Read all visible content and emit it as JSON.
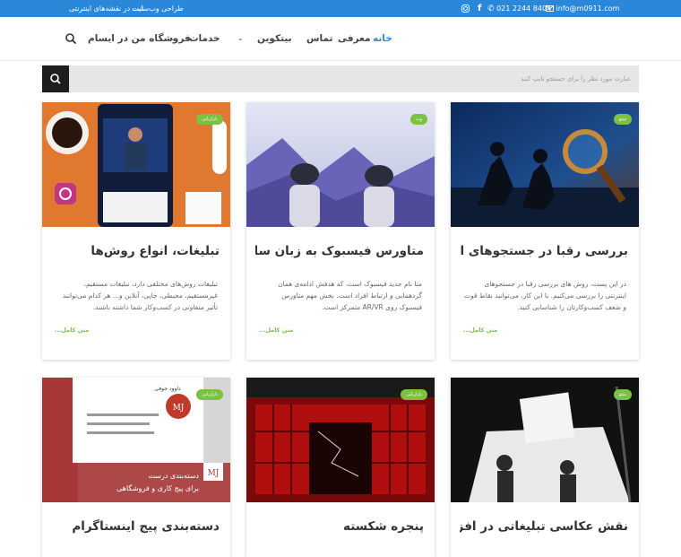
{
  "topbar": {
    "email": "info@m0911.com",
    "phone": "021 2244 8404",
    "link_web": "طراحی وب‌سایت",
    "link_maps": "ثبت در نقشه‌های اینترنتی",
    "icons": [
      "email-icon",
      "phone-icon",
      "facebook-icon",
      "instagram-icon"
    ]
  },
  "nav": {
    "home": "خانه",
    "about": "معرفی",
    "contact": "تماس",
    "bitcoin": "بیتکوین",
    "services": "خدمات",
    "shop": "فروشگاه من در ایسام"
  },
  "search": {
    "placeholder": "عبارت مورد نظر را برای جستجو تایپ کنید"
  },
  "cards": [
    {
      "badge": "سئو",
      "title": "بررسی رقبا در جستجوهای اینترنتی",
      "excerpt": "در این پست، روش های بررسی رقبا در جستجوهای اینترنتی را بررسی می‌کنیم. با این کار، می‌توانید نقاط قوت و ضعف کسب‌وکارتان را شناسایی کنید.",
      "more": "متن کامل..."
    },
    {
      "badge": "وب",
      "title": "متاورس فیسبوک به زبان ساده",
      "excerpt": "متا نام جدید فیسبوک است، که هدفش ادامه‌ی همان گردهمایی و ارتباط افراد است. بخش مهم متاورس فیسبوک روی AR/VR متمرکز است.",
      "more": "متن کامل..."
    },
    {
      "badge": "بازاریابی",
      "title": "تبلیغات، انواع روش‌ها",
      "excerpt": "تبلیغات روش‌های مختلفی دارد، تبلیغات مستقیم، غیرمستقیم، محیطی، چاپی، آنلاین و... هر کدام می‌توانند تأثیر متفاوتی در کسب‌وکار شما داشته باشند.",
      "more": "متن کامل..."
    },
    {
      "badge": "سئو",
      "title": "نقش عکاسی تبلیغاتی در افزایش"
    },
    {
      "badge": "بازاریابی",
      "title": "پنجره شکسته"
    },
    {
      "badge": "بازاریابی",
      "title": "دسته‌بندی پیج اینستاگرام",
      "image_text": {
        "line1": "دسته‌بندی درست",
        "line2": "برای پیج کاری و فروشگاهی",
        "logo": "MJ",
        "profile_name": "داوود جوفی"
      }
    }
  ]
}
